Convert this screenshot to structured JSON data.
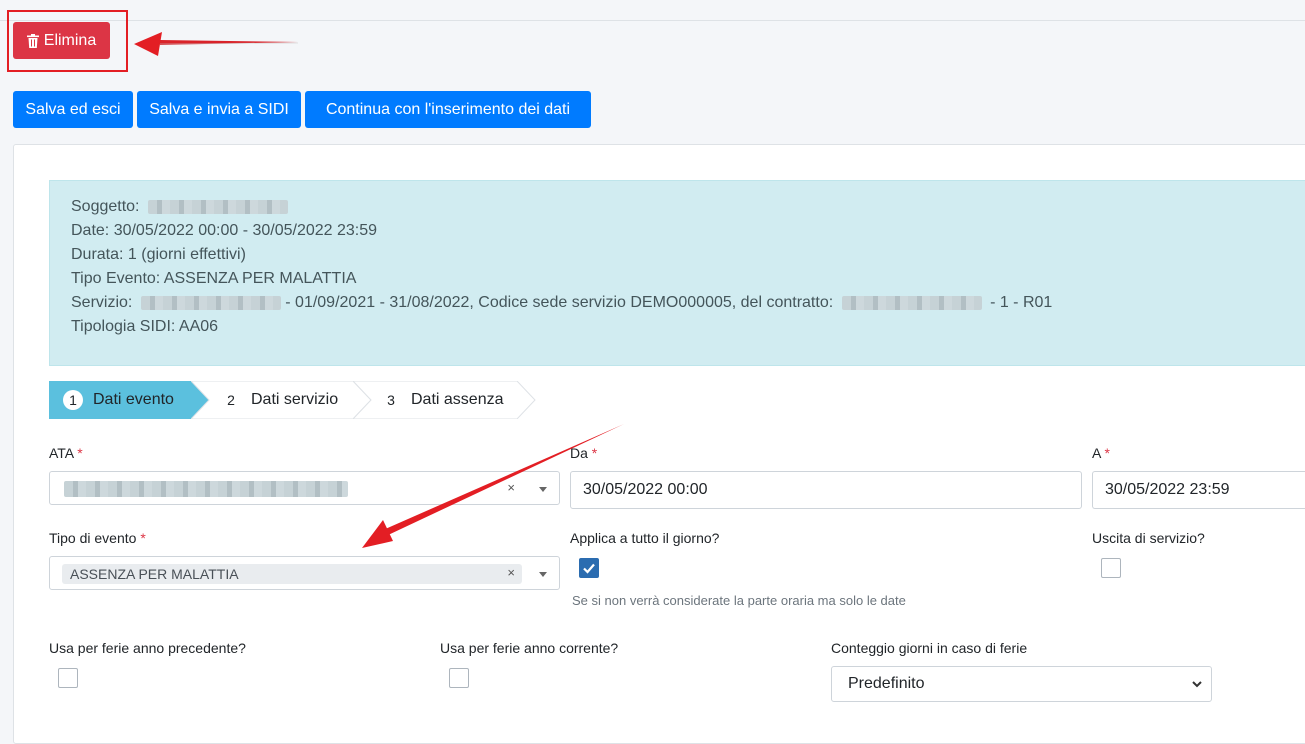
{
  "toolbar": {
    "delete_label": "Elimina",
    "save_exit_label": "Salva ed esci",
    "save_send_label": "Salva e invia a SIDI",
    "continue_label": "Continua con l'inserimento dei dati"
  },
  "info": {
    "subject_label": "Soggetto:",
    "date_text": "Date: 30/05/2022 00:00 - 30/05/2022 23:59",
    "duration_text": "Durata: 1 (giorni effettivi)",
    "event_type_text": "Tipo Evento: ASSENZA PER MALATTIA",
    "service_label": "Servizio:",
    "service_mid": "- 01/09/2021 - 31/08/2022, Codice sede servizio DEMO000005, del contratto:",
    "service_end": "- 1 - R01",
    "sidi_text": "Tipologia SIDI: AA06"
  },
  "steps": [
    {
      "num": "1",
      "label": "Dati evento"
    },
    {
      "num": "2",
      "label": "Dati servizio"
    },
    {
      "num": "3",
      "label": "Dati assenza"
    }
  ],
  "form": {
    "ata_label": "ATA",
    "required_mark": "*",
    "da_label": "Da",
    "da_value": "30/05/2022 00:00",
    "a_label": "A",
    "a_value": "30/05/2022 23:59",
    "event_type_label": "Tipo di evento",
    "event_type_value": "ASSENZA PER MALATTIA",
    "clear_mark": "×",
    "all_day_label": "Applica a tutto il giorno?",
    "all_day_help": "Se si non verrà considerate la parte oraria ma solo le date",
    "service_exit_label": "Uscita di servizio?",
    "prev_year_label": "Usa per ferie anno precedente?",
    "curr_year_label": "Usa per ferie anno corrente?",
    "count_days_label": "Conteggio giorni in caso di ferie",
    "count_days_value": "Predefinito"
  }
}
